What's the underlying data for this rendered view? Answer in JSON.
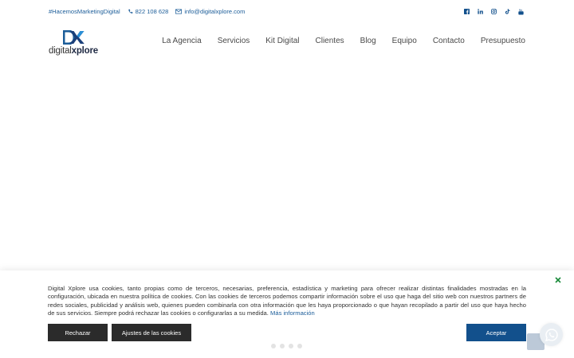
{
  "topbar": {
    "hashtag": "#HacemosMarketingDigital",
    "phone": "822 108 628",
    "email": "info@digitalxplore.com",
    "social_icons": [
      "facebook-icon",
      "linkedin-icon",
      "instagram-icon",
      "tiktok-icon",
      "youtube-icon"
    ]
  },
  "logo": {
    "word_light": "digital",
    "word_bold": "xplore"
  },
  "nav": {
    "items": [
      "La Agencia",
      "Servicios",
      "Kit Digital",
      "Clientes",
      "Blog",
      "Equipo",
      "Contacto",
      "Presupuesto"
    ]
  },
  "cookie": {
    "text": "Digital Xplore usa cookies, tanto propias como de terceros, necesarias, preferencia, estadística y marketing para ofrecer realizar distintas finalidades mostradas en la configuración, ubicada en nuestra política de cookies. Con las cookies de terceros podemos compartir información sobre el uso que haga del sitio web con nuestros partners de redes sociales, publicidad y análisis web, quienes pueden combinarla con otra información que les haya proporcionado o que hayan recopilado a partir del uso que haya hecho de sus servicios. Siempre podrá rechazar las cookies o configurarlas a su medida.",
    "more_link": "Más información",
    "reject": "Rechazar",
    "settings": "Ajustes de las cookies",
    "accept": "Aceptar",
    "close": "×"
  },
  "colors": {
    "brand_blue": "#1c5d99",
    "accept_blue": "#12508c",
    "dark_button": "#2b2b2b"
  }
}
